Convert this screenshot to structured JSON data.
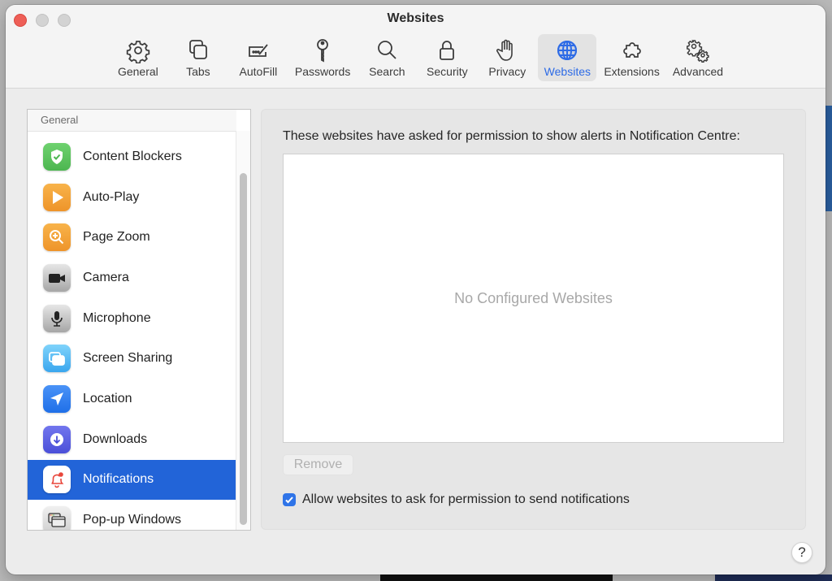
{
  "window": {
    "title": "Websites"
  },
  "toolbar": {
    "items": [
      {
        "label": "General",
        "icon": "gear-icon"
      },
      {
        "label": "Tabs",
        "icon": "tabs-icon"
      },
      {
        "label": "AutoFill",
        "icon": "autofill-icon"
      },
      {
        "label": "Passwords",
        "icon": "key-icon"
      },
      {
        "label": "Search",
        "icon": "magnifier-icon"
      },
      {
        "label": "Security",
        "icon": "lock-icon"
      },
      {
        "label": "Privacy",
        "icon": "hand-icon"
      },
      {
        "label": "Websites",
        "icon": "globe-icon",
        "active": true
      },
      {
        "label": "Extensions",
        "icon": "puzzle-icon"
      },
      {
        "label": "Advanced",
        "icon": "gears-icon"
      }
    ],
    "accent": "#2d6be6"
  },
  "sidebar": {
    "section_header": "General",
    "items": [
      {
        "label": "Content Blockers",
        "icon": "shield-check-icon",
        "color": "#5cc45f"
      },
      {
        "label": "Auto-Play",
        "icon": "play-icon",
        "color": "#f3a23a"
      },
      {
        "label": "Page Zoom",
        "icon": "zoom-icon",
        "color": "#f3a23a"
      },
      {
        "label": "Camera",
        "icon": "camera-icon",
        "color": "#a8a8a8"
      },
      {
        "label": "Microphone",
        "icon": "microphone-icon",
        "color": "#a8a8a8"
      },
      {
        "label": "Screen Sharing",
        "icon": "screen-sharing-icon",
        "color": "#5ab8f0"
      },
      {
        "label": "Location",
        "icon": "location-arrow-icon",
        "color": "#2f7ef2"
      },
      {
        "label": "Downloads",
        "icon": "download-icon",
        "color": "#5a5ee0"
      },
      {
        "label": "Notifications",
        "icon": "bell-icon",
        "color": "#ffffff",
        "selected": true
      },
      {
        "label": "Pop-up Windows",
        "icon": "popup-windows-icon",
        "color": "#d8d8d8"
      }
    ],
    "selection_color": "#2264d8"
  },
  "panel": {
    "description": "These websites have asked for permission to show alerts in Notification Centre:",
    "empty_text": "No Configured Websites",
    "remove_label": "Remove",
    "allow_label": "Allow websites to ask for permission to send notifications",
    "allow_checked": true
  },
  "help": {
    "label": "?"
  }
}
